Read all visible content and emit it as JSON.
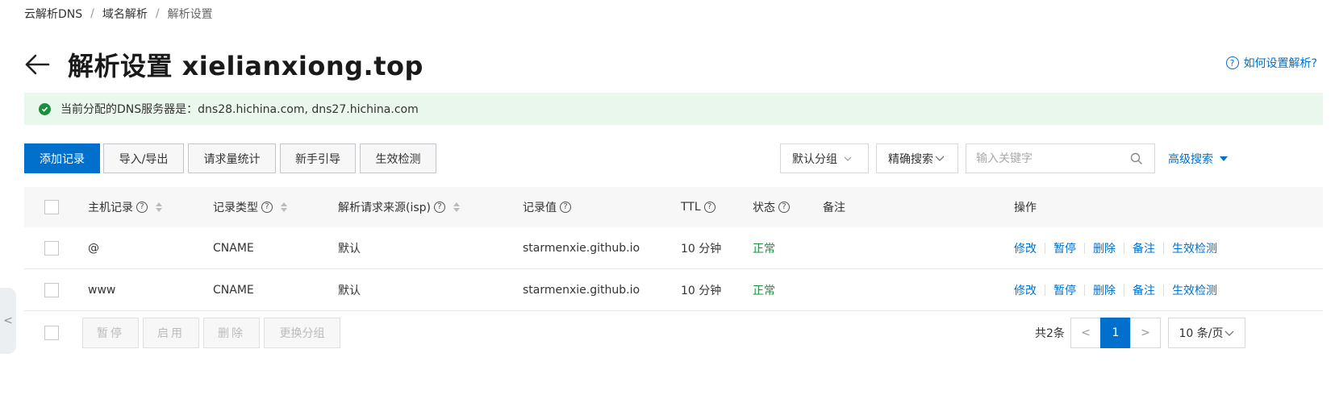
{
  "breadcrumb": {
    "items": [
      "云解析DNS",
      "域名解析",
      "解析设置"
    ],
    "separator": "/"
  },
  "header": {
    "title": "解析设置 xielianxiong.top",
    "help_link": "如何设置解析?"
  },
  "alert": {
    "text": "当前分配的DNS服务器是：dns28.hichina.com, dns27.hichina.com"
  },
  "toolbar": {
    "add_record": "添加记录",
    "import_export": "导入/导出",
    "request_stats": "请求量统计",
    "guide": "新手引导",
    "check": "生效检测",
    "group_select": "默认分组",
    "search_mode": "精确搜索",
    "search_placeholder": "输入关键字",
    "advanced_search": "高级搜索"
  },
  "table": {
    "columns": {
      "host": "主机记录",
      "type": "记录类型",
      "isp": "解析请求来源(isp)",
      "value": "记录值",
      "ttl": "TTL",
      "status": "状态",
      "remark": "备注",
      "actions": "操作"
    },
    "rows": [
      {
        "host": "@",
        "type": "CNAME",
        "isp": "默认",
        "value": "starmenxie.github.io",
        "ttl": "10 分钟",
        "status": "正常",
        "remark": ""
      },
      {
        "host": "www",
        "type": "CNAME",
        "isp": "默认",
        "value": "starmenxie.github.io",
        "ttl": "10 分钟",
        "status": "正常",
        "remark": ""
      }
    ],
    "row_actions": [
      "修改",
      "暂停",
      "删除",
      "备注",
      "生效检测"
    ]
  },
  "footer": {
    "pause": "暂停",
    "enable": "启用",
    "delete": "删除",
    "change_group": "更换分组",
    "total": "共2条",
    "prev": "<",
    "current_page": "1",
    "next": ">",
    "page_size": "10 条/页"
  },
  "side_handle": "<",
  "colors": {
    "primary": "#0070cc",
    "success": "#1e8e3e",
    "alert_bg": "#e9f7ec"
  },
  "icons": {
    "back": "arrow-left-icon",
    "help": "question-circle-icon",
    "ok": "check-circle-icon",
    "search": "search-icon",
    "caret": "chevron-down-icon",
    "sort": "sort-icon"
  }
}
